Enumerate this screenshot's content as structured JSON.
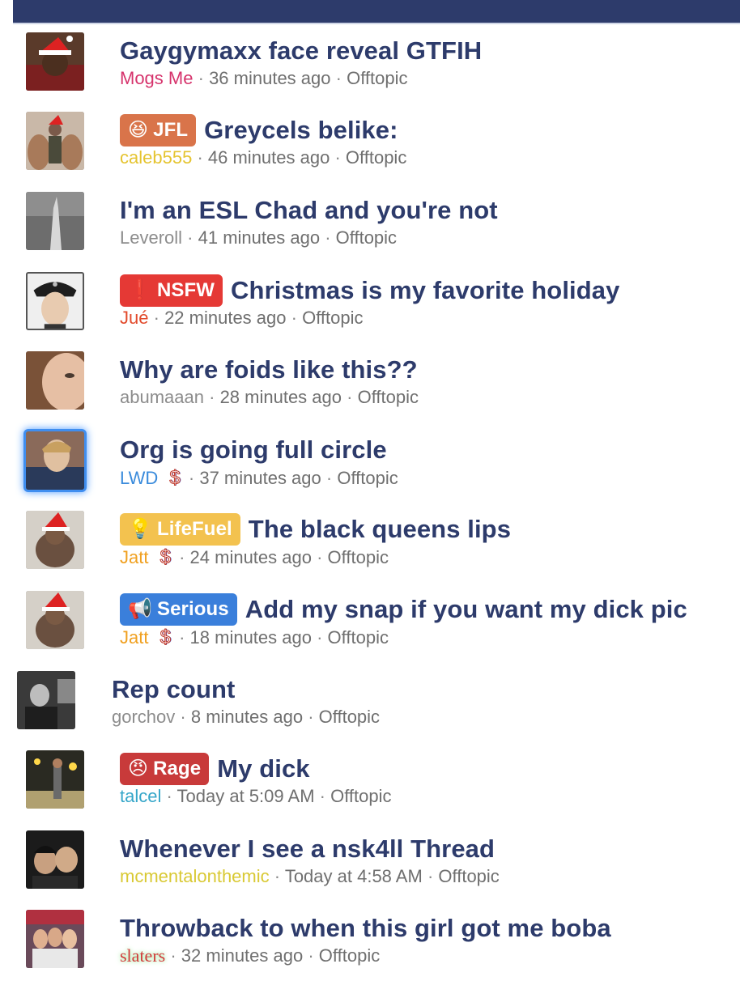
{
  "threads": [
    {
      "title": "Gaygymaxx face reveal GTFIH",
      "prefix": null,
      "author": "Mogs Me",
      "author_color": "#d6336c",
      "time": "36 minutes ago",
      "forum": "Offtopic",
      "donor": false
    },
    {
      "title": "Greycels belike:",
      "prefix": {
        "label": "JFL",
        "icon": "laugh-face-icon",
        "color": "#d9744a"
      },
      "author": "caleb555",
      "author_color": "#e5c430",
      "time": "46 minutes ago",
      "forum": "Offtopic",
      "donor": false
    },
    {
      "title": "I'm an ESL Chad and you're not",
      "prefix": null,
      "author": "Leveroll",
      "author_color": "#8c8c8c",
      "time": "41 minutes ago",
      "forum": "Offtopic",
      "donor": false
    },
    {
      "title": "Christmas is my favorite holiday",
      "prefix": {
        "label": "NSFW",
        "icon": "exclamation-circle-icon",
        "color": "#e53935"
      },
      "author": "Jué",
      "author_color": "#e24a2b",
      "time": "22 minutes ago",
      "forum": "Offtopic",
      "donor": false
    },
    {
      "title": "Why are foids like this??",
      "prefix": null,
      "author": "abumaaan",
      "author_color": "#8c8c8c",
      "time": "28 minutes ago",
      "forum": "Offtopic",
      "donor": false
    },
    {
      "title": "Org is going full circle",
      "prefix": null,
      "author": "LWD",
      "author_color": "#3a8bdc",
      "time": "37 minutes ago",
      "forum": "Offtopic",
      "donor": true
    },
    {
      "title": "The black queens lips",
      "prefix": {
        "label": "LifeFuel",
        "icon": "lightbulb-icon",
        "color": "#f3c24f"
      },
      "author": "Jatt",
      "author_color": "#f0a020",
      "time": "24 minutes ago",
      "forum": "Offtopic",
      "donor": true
    },
    {
      "title": "Add my snap if you want my dick pic",
      "prefix": {
        "label": "Serious",
        "icon": "megaphone-icon",
        "color": "#3a7fdb"
      },
      "author": "Jatt",
      "author_color": "#f0a020",
      "time": "18 minutes ago",
      "forum": "Offtopic",
      "donor": true
    },
    {
      "title": "Rep count",
      "prefix": null,
      "author": "gorchov",
      "author_color": "#8c8c8c",
      "time": "8 minutes ago",
      "forum": "Offtopic",
      "donor": false
    },
    {
      "title": "My dick",
      "prefix": {
        "label": "Rage",
        "icon": "angry-face-icon",
        "color": "#c83a3a"
      },
      "author": "talcel",
      "author_color": "#35a6c9",
      "time": "Today at 5:09 AM",
      "forum": "Offtopic",
      "donor": false
    },
    {
      "title": "Whenever I see a nsk4ll Thread",
      "prefix": null,
      "author": "mcmentalonthemic",
      "author_color": "#d9c934",
      "time": "Today at 4:58 AM",
      "forum": "Offtopic",
      "donor": false
    },
    {
      "title": "Throwback to when this girl got me boba",
      "prefix": null,
      "author": "slaters",
      "author_color": "#d23a3a",
      "time": "32 minutes ago",
      "forum": "Offtopic",
      "donor": false
    }
  ],
  "separator": "·",
  "donor_symbol": "$",
  "prefix_glyphs": {
    "laugh-face-icon": "😆",
    "exclamation-circle-icon": "❗",
    "lightbulb-icon": "💡",
    "megaphone-icon": "📢",
    "angry-face-icon": "😠"
  },
  "colors": {
    "topbar": "#2d3b6b",
    "title": "#2d3b6b",
    "meta": "#6f6f6f"
  }
}
